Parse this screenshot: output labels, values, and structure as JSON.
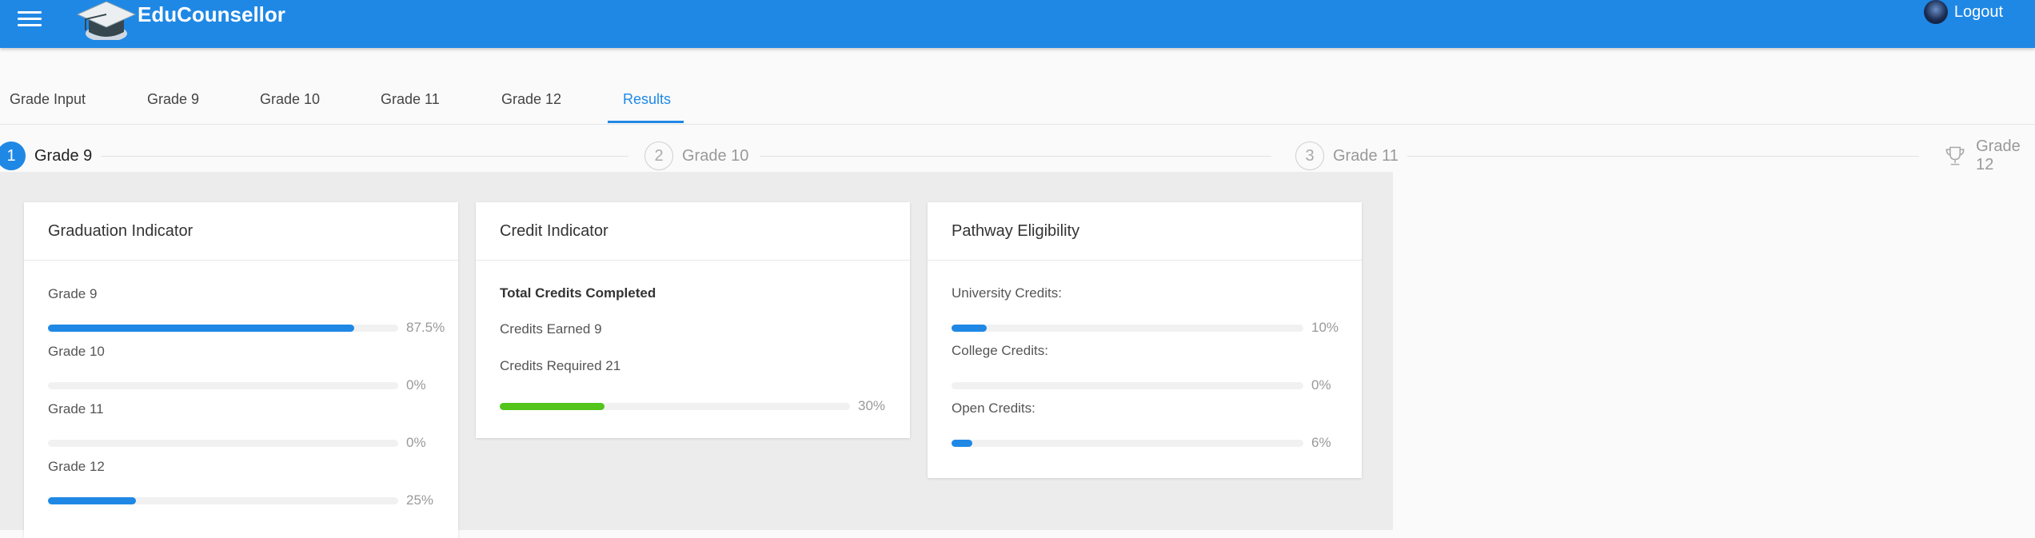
{
  "header": {
    "brand": "EduCounsellor",
    "logout_label": "Logout",
    "color": "#1f88e5",
    "icons": [
      "menu-icon",
      "graduation-cap-icon",
      "user-avatar"
    ]
  },
  "tabs": [
    "Grade Input",
    "Grade 9",
    "Grade 10",
    "Grade 11",
    "Grade 12",
    "Results"
  ],
  "active_tab": "Results",
  "stepper": {
    "steps": [
      {
        "number": "1",
        "label": "Grade 9"
      },
      {
        "number": "2",
        "label": "Grade 10"
      },
      {
        "number": "3",
        "label": "Grade 11"
      },
      {
        "number": "",
        "label": "Grade 12",
        "icon": "trophy-icon"
      }
    ],
    "active_step": "Grade 9"
  },
  "graduation": {
    "title": "Graduation Indicator",
    "rows": [
      {
        "label": "Grade 9",
        "percent_label": "87.5%",
        "fill": 0.875
      },
      {
        "label": "Grade 10",
        "percent_label": "0%",
        "fill": 0
      },
      {
        "label": "Grade 11",
        "percent_label": "0%",
        "fill": 0
      },
      {
        "label": "Grade 12",
        "percent_label": "25%",
        "fill": 0.25
      }
    ]
  },
  "credit": {
    "title": "Credit Indicator",
    "total_label": "Total Credits Completed",
    "earned_label": "Credits Earned 9",
    "required_label": "Credits Required 21",
    "percent_label": "30%",
    "fill": 0.3,
    "bar_color": "#52c41a"
  },
  "pathway": {
    "title": "Pathway Eligibility",
    "rows": [
      {
        "label": "University Credits:",
        "percent_label": "10%",
        "fill": 0.1
      },
      {
        "label": "College Credits:",
        "percent_label": "0%",
        "fill": 0
      },
      {
        "label": "Open Credits:",
        "percent_label": "6%",
        "fill": 0.06
      }
    ]
  }
}
